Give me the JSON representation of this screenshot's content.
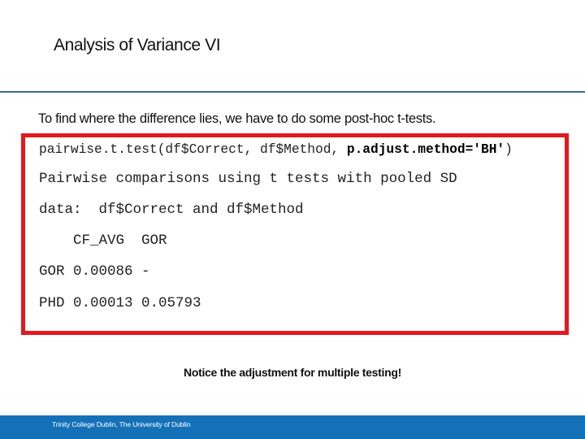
{
  "slide": {
    "title": "Analysis of Variance VI",
    "intro": "To find where the difference lies, we have to do some post-hoc t-tests.",
    "note": "Notice the adjustment for multiple testing!"
  },
  "code_box": {
    "border_color": "#e5171f",
    "command": {
      "plain": "pairwise.t.test(df$Correct, df$Method, ",
      "bold": "p.adjust.method='BH'",
      "close": ")"
    },
    "output_lines": [
      "Pairwise comparisons using t tests with pooled SD",
      "data:  df$Correct and df$Method",
      "    CF_AVG  GOR",
      "GOR 0.00086 -",
      "PHD 0.00013 0.05793"
    ],
    "result_table": {
      "columns": [
        "CF_AVG",
        "GOR"
      ],
      "rows": [
        {
          "label": "GOR",
          "values": [
            "0.00086",
            "-"
          ]
        },
        {
          "label": "PHD",
          "values": [
            "0.00013",
            "0.05793"
          ]
        }
      ]
    }
  },
  "footer": {
    "text": "Trinity College Dublin, The University of Dublin",
    "color": "#1471b8"
  },
  "colors": {
    "divider": "#3c6e80",
    "accent_red": "#e5171f",
    "footer_blue": "#1471b8"
  }
}
